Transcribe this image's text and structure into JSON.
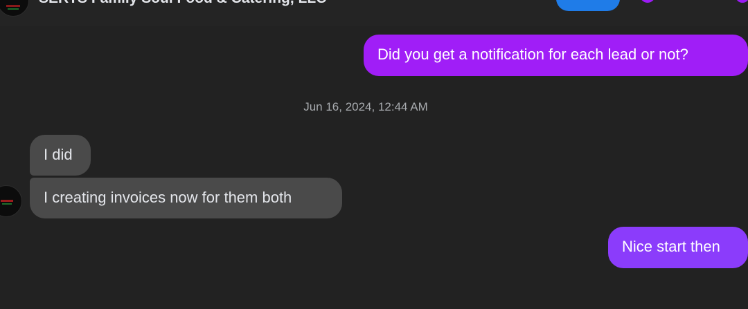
{
  "header": {
    "title": "SERTS Family Soul Food & Catering, LLC"
  },
  "messages": [
    {
      "direction": "outgoing",
      "text": "Did you get a notification for each lead or not?"
    },
    {
      "direction": "incoming",
      "text": "I did"
    },
    {
      "direction": "incoming",
      "text": "I creating invoices now for them both"
    },
    {
      "direction": "outgoing",
      "text": "Nice start then"
    }
  ],
  "timestamp": "Jun 16, 2024, 12:44 AM",
  "colors": {
    "background": "#222222",
    "outgoing_bubble": "#a01ef7",
    "outgoing_bubble_latest": "#8b3cfb",
    "incoming_bubble": "#4a4a4a",
    "accent_blue": "#1f7ce8"
  }
}
